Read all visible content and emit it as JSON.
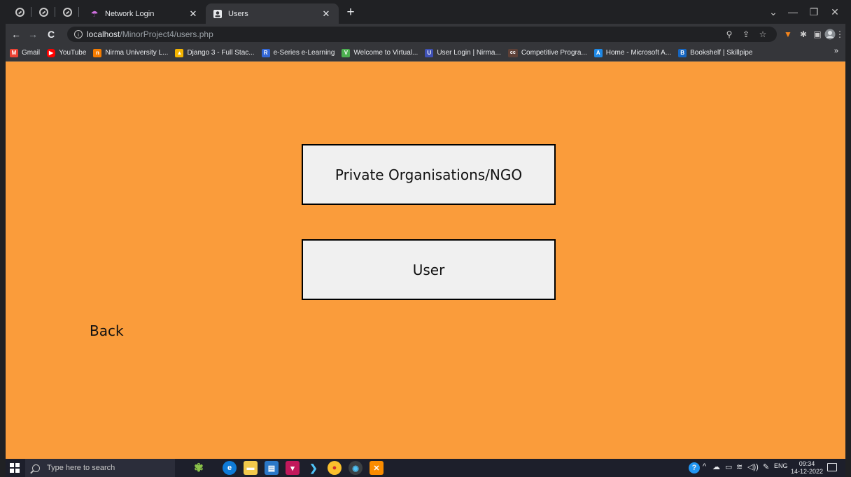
{
  "browser": {
    "tabs": [
      {
        "title": "Network Login",
        "active": false
      },
      {
        "title": "Users",
        "active": true
      }
    ],
    "new_tab_label": "+",
    "window_controls": {
      "tab_search": "⌄",
      "minimize": "—",
      "maximize": "❐",
      "close": "✕"
    },
    "nav": {
      "back": "←",
      "forward": "→",
      "reload": "C"
    },
    "address": {
      "host": "localhost",
      "path": "/MinorProject4/users.php"
    },
    "bookmarks": [
      {
        "label": "Gmail",
        "color": "#ea4335",
        "glyph": "M"
      },
      {
        "label": "YouTube",
        "color": "#ff0000",
        "glyph": "▶"
      },
      {
        "label": "Nirma University L...",
        "color": "#f57c00",
        "glyph": "n"
      },
      {
        "label": "Django 3 - Full Stac...",
        "color": "#f4b400",
        "glyph": "▲"
      },
      {
        "label": "e-Series e-Learning",
        "color": "#3367d6",
        "glyph": "R"
      },
      {
        "label": "Welcome to Virtual...",
        "color": "#4caf50",
        "glyph": "V"
      },
      {
        "label": "User Login | Nirma...",
        "color": "#3f51b5",
        "glyph": "U"
      },
      {
        "label": "Competitive Progra...",
        "color": "#5d4037",
        "glyph": "cc"
      },
      {
        "label": "Home - Microsoft A...",
        "color": "#1e88e5",
        "glyph": "A"
      },
      {
        "label": "Bookshelf | Skillpipe",
        "color": "#1565c0",
        "glyph": "B"
      }
    ],
    "bookmarks_more": "»"
  },
  "page": {
    "background": "#fa9c3b",
    "buttons": [
      {
        "label": "Private Organisations/NGO"
      },
      {
        "label": "User"
      }
    ],
    "back_label": "Back"
  },
  "taskbar": {
    "search_placeholder": "Type here to search",
    "language": "ENG",
    "time": "09:34",
    "date": "14-12-2022"
  }
}
